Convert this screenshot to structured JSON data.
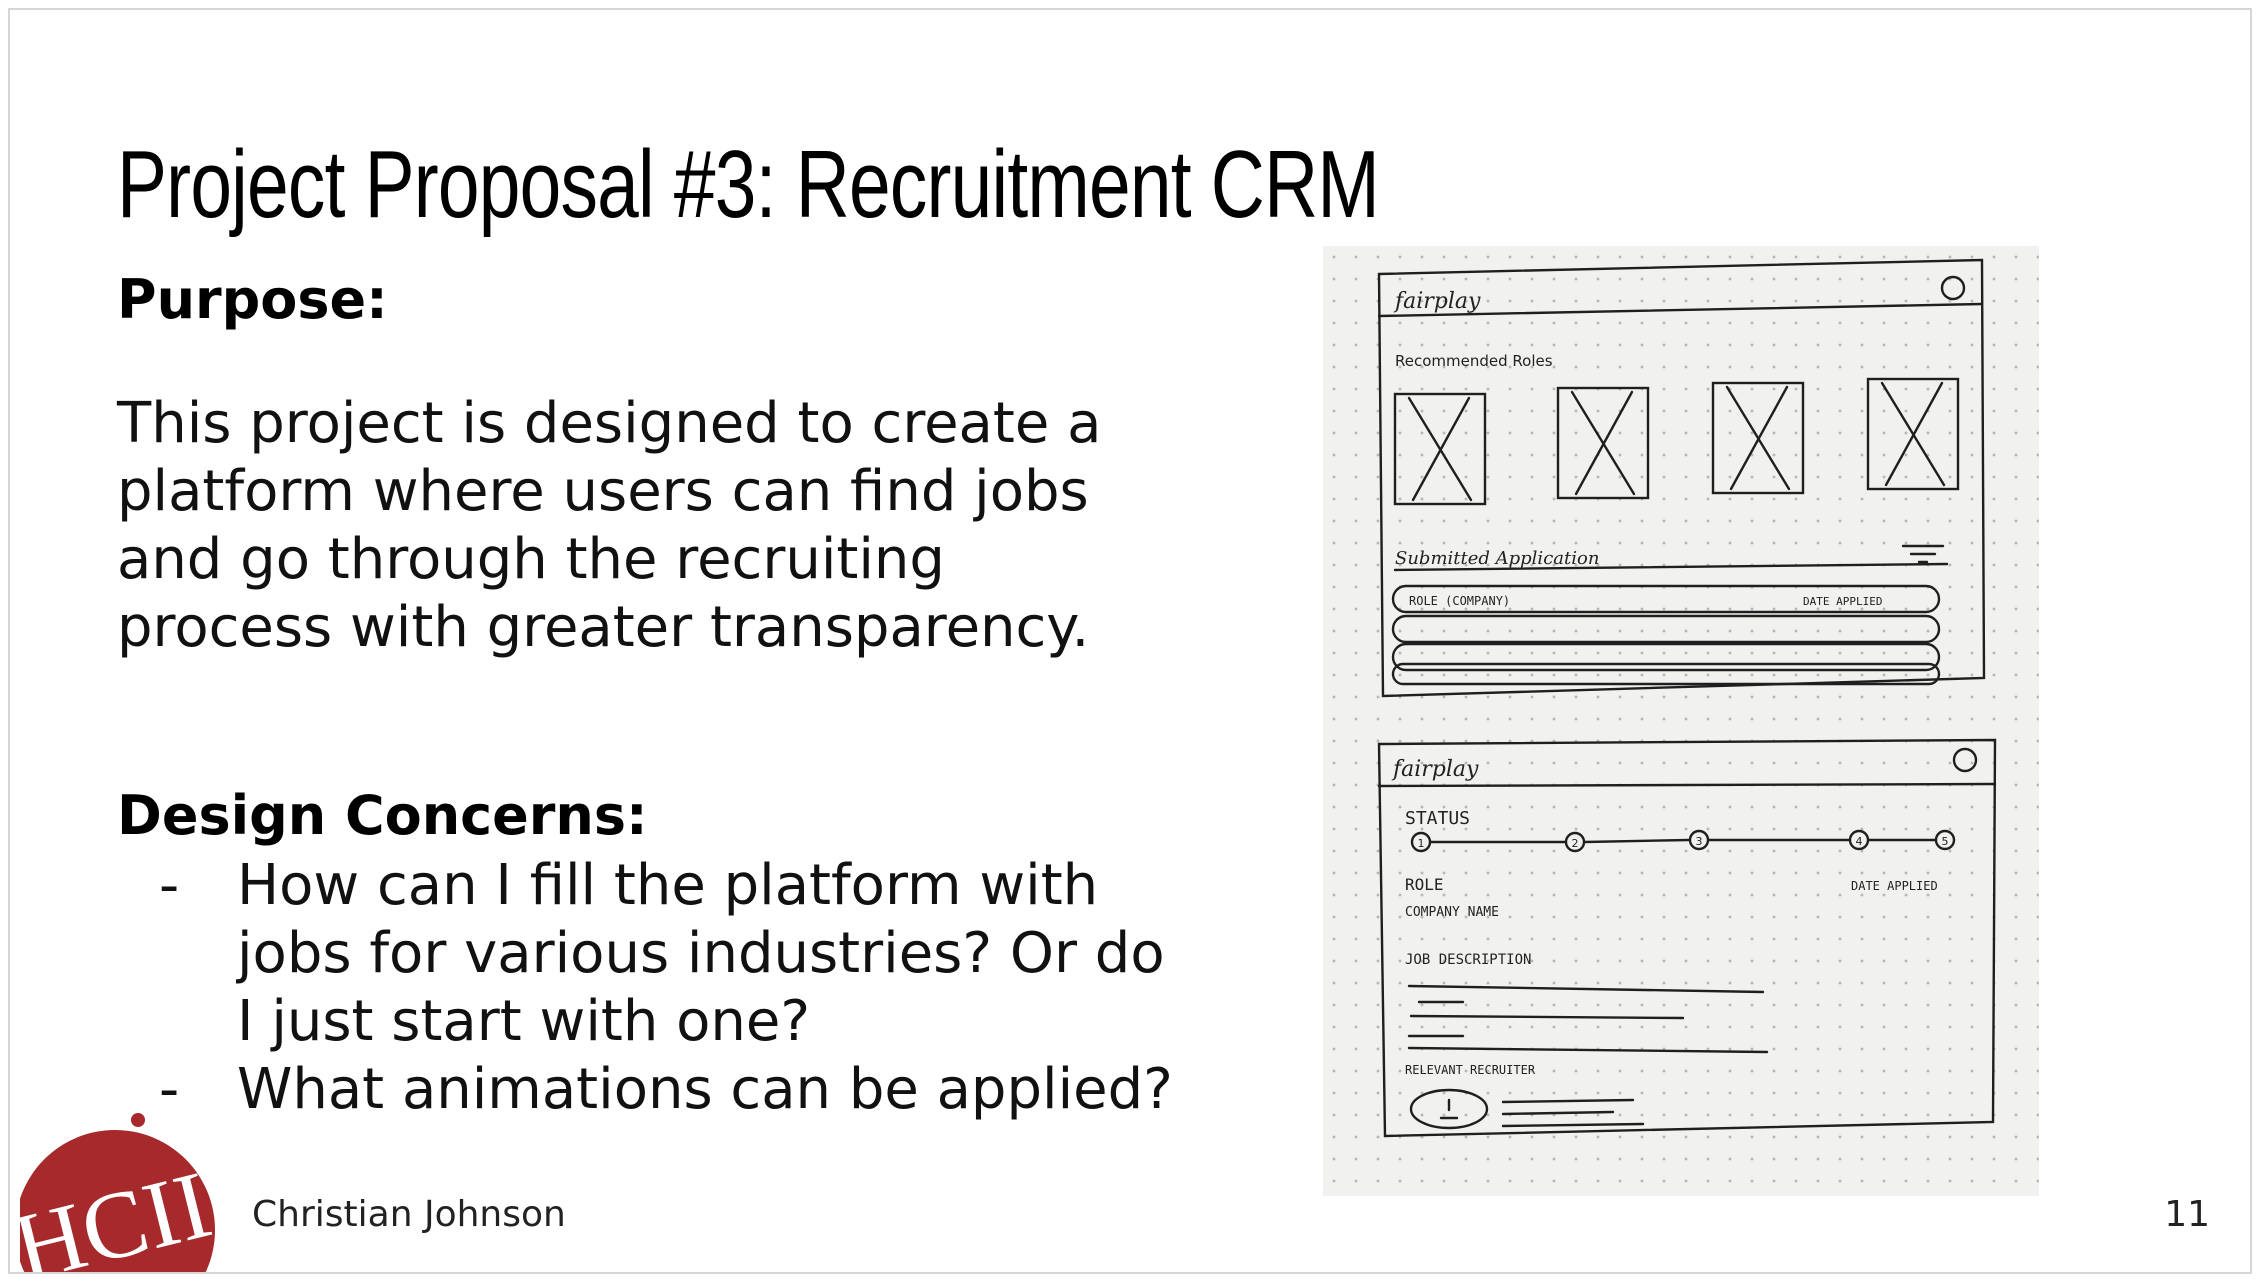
{
  "slide": {
    "title": "Project Proposal #3: Recruitment CRM",
    "purpose_heading": "Purpose:",
    "purpose_text": "This project is designed to create a platform where users can find jobs and go through the recruiting process with greater transparency.",
    "concerns_heading": "Design Concerns:",
    "concerns": [
      "How can I fill the platform with jobs for various industries? Or do I just start with one?",
      "What animations can be applied?"
    ],
    "bullet_marker": "-",
    "author": "Christian Johnson",
    "page_number": "11"
  },
  "logo": {
    "text": "HCII",
    "color": "#a6292b"
  },
  "sketch": {
    "screen1": {
      "brand": "fairplay",
      "recommended_label": "Recommended Roles",
      "submitted_label": "Submitted Application",
      "row_role": "ROLE (COMPANY)",
      "row_date": "DATE APPLIED"
    },
    "screen2": {
      "brand": "fairplay",
      "status_label": "STATUS",
      "steps": [
        "1",
        "2",
        "3",
        "4",
        "5"
      ],
      "role_label": "ROLE",
      "company_label": "COMPANY NAME",
      "date_label": "DATE APPLIED",
      "job_desc_label": "JOB DESCRIPTION",
      "recruiter_label": "RELEVANT RECRUITER"
    }
  }
}
